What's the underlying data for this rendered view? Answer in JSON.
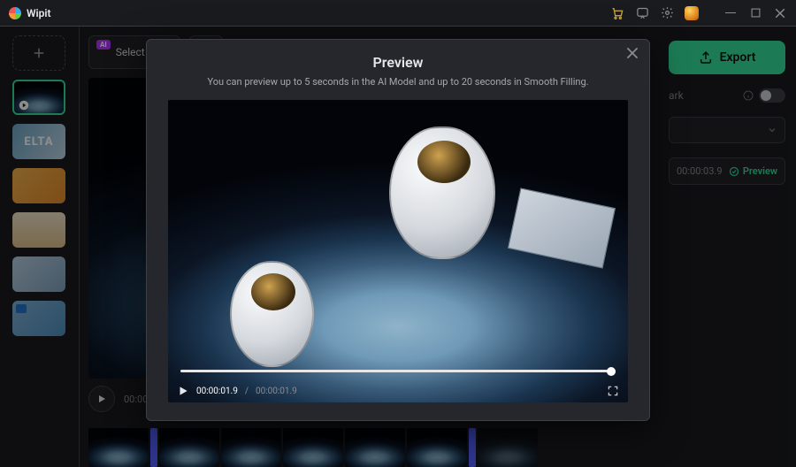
{
  "title": {
    "product": "Wipit"
  },
  "toolbar": {
    "ai_tag": "AI",
    "select_area_label": "Select Area",
    "export_label": "Export"
  },
  "right_panel": {
    "mark_label": "ark",
    "time": "00:00:03.9",
    "preview_label": "Preview"
  },
  "viewer": {
    "time": "00:00"
  },
  "modal": {
    "title": "Preview",
    "subtitle": "You can preview up to 5 seconds in the AI Model and up to 20 seconds in Smooth Filling.",
    "current_time": "00:00:01.9",
    "total_time": "00:00:01.9"
  },
  "thumbs": {
    "t2": "ELTA"
  },
  "separator": "/"
}
